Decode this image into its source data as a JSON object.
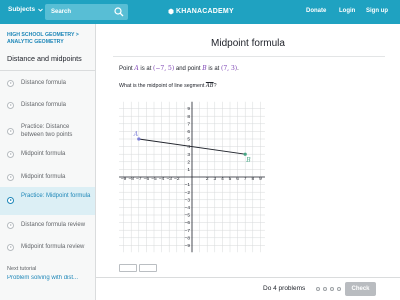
{
  "topbar": {
    "subjects": "Subjects",
    "search_label": "Search",
    "logo": "KHANACADEMY",
    "links": [
      "Donate",
      "Login",
      "Sign up"
    ]
  },
  "sidebar": {
    "breadcrumb": "HIGH SCHOOL GEOMETRY > ANALYTIC GEOMETRY",
    "title": "Distance and midpoints",
    "items": [
      {
        "label": "Distance formula"
      },
      {
        "label": "Distance formula"
      },
      {
        "label": "Practice: Distance between two points"
      },
      {
        "label": "Midpoint formula"
      },
      {
        "label": "Midpoint formula"
      },
      {
        "label": "Practice: Midpoint formula"
      },
      {
        "label": "Distance formula review"
      },
      {
        "label": "Midpoint formula review"
      }
    ],
    "active_index": 5,
    "next_label": "Next tutorial",
    "next_link": "Problem solving with dist..."
  },
  "main": {
    "title": "Midpoint formula",
    "problem": {
      "p1": "Point ",
      "a": "A",
      "mid1": " is at ",
      "a_coord": "(−7, 5)",
      "mid2": " and point ",
      "b": "B",
      "mid3": " is at ",
      "b_coord": "(7, 3)",
      "end": "."
    },
    "question_prefix": "What is the midpoint of line segment ",
    "question_segment": "AB",
    "question_suffix": "?"
  },
  "graph": {
    "x_ticks": [
      "−9",
      "−8",
      "−7",
      "−6",
      "−5",
      "−4",
      "−3",
      "−2",
      "",
      "",
      "2",
      "3",
      "4",
      "5",
      "6",
      "7",
      "8",
      "9"
    ],
    "y_ticks": [
      "9",
      "8",
      "7",
      "6",
      "5",
      "4",
      "3",
      "2",
      "1",
      "",
      "−1",
      "−2",
      "−3",
      "−4",
      "−5",
      "−6",
      "−7",
      "−8",
      "−9"
    ],
    "point_a_label": "A",
    "point_b_label": "B",
    "colors": {
      "point_a": "#7b7ed6",
      "point_b": "#46a583",
      "line": "#21242c",
      "grid": "#d7d9db"
    }
  },
  "footer": {
    "do_problems": "Do 4 problems",
    "check": "Check"
  }
}
